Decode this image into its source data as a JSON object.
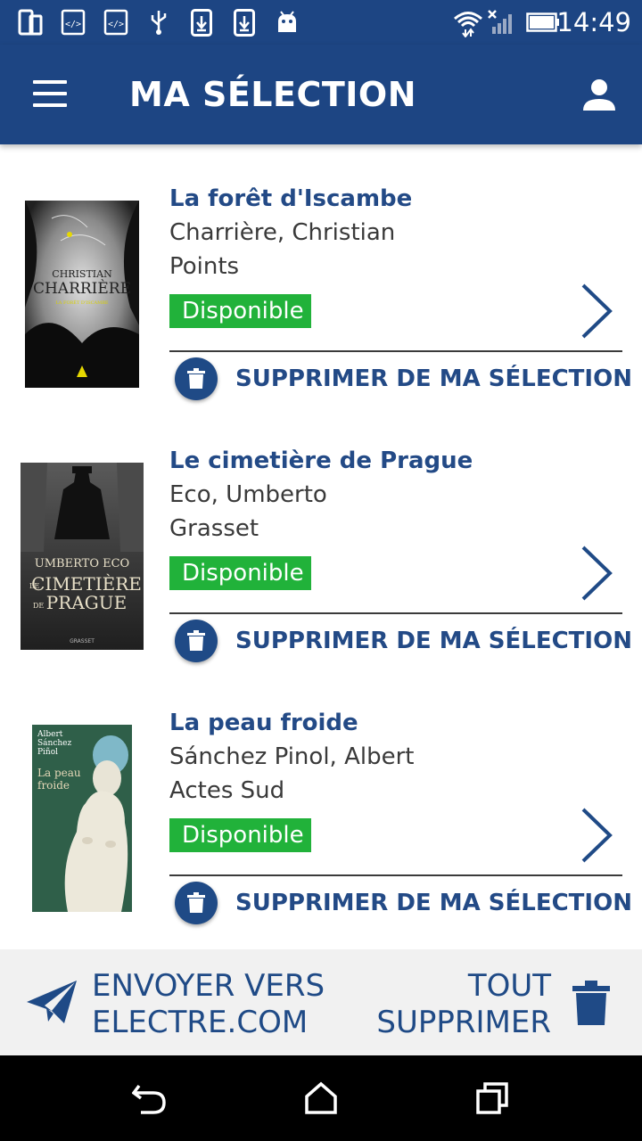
{
  "status_bar": {
    "time": "14:49",
    "icons": [
      "device-icon",
      "code-icon",
      "code-icon",
      "usb-icon",
      "download-icon",
      "download-icon",
      "android-icon",
      "wifi-icon",
      "no-signal-icon",
      "battery-icon"
    ]
  },
  "app_bar": {
    "title": "MA SÉLECTION",
    "menu_icon": "hamburger-menu-icon",
    "account_icon": "person-icon"
  },
  "books": [
    {
      "title": "La forêt d'Iscambe",
      "author": "Charrière, Christian",
      "publisher": "Points",
      "availability": "Disponible",
      "delete_label": "SUPPRIMER DE MA SÉLECTION",
      "cover": {
        "top_text": "CHRISTIAN",
        "main_text": "CHARRIÈRE",
        "sub_text": "LA FORÊT D'ISCAMBE"
      }
    },
    {
      "title": "Le cimetière de Prague",
      "author": "Eco, Umberto",
      "publisher": "Grasset",
      "availability": "Disponible",
      "delete_label": "SUPPRIMER DE MA SÉLECTION",
      "cover": {
        "top_text": "UMBERTO ECO",
        "main_text": "CIMETIÈRE",
        "prefix_text": "LE",
        "bottom_prefix": "DE",
        "bottom_text": "PRAGUE",
        "publisher_mark": "GRASSET"
      }
    },
    {
      "title": "La peau froide",
      "author": "Sánchez Pinol, Albert",
      "publisher": "Actes Sud",
      "availability": "Disponible",
      "delete_label": "SUPPRIMER DE MA SÉLECTION",
      "cover": {
        "author_lines": [
          "Albert",
          "Sánchez",
          "Piñol"
        ],
        "title_lines": [
          "La peau",
          "froide"
        ]
      }
    }
  ],
  "action_bar": {
    "send_label_line1": "ENVOYER VERS",
    "send_label_line2": "ELECTRE.COM",
    "clear_label_line1": "TOUT",
    "clear_label_line2": "SUPPRIMER"
  },
  "colors": {
    "primary": "#1d4583",
    "title_text": "#234a86",
    "available_green": "#21b23a",
    "action_bar_bg": "#f1f1f1"
  }
}
